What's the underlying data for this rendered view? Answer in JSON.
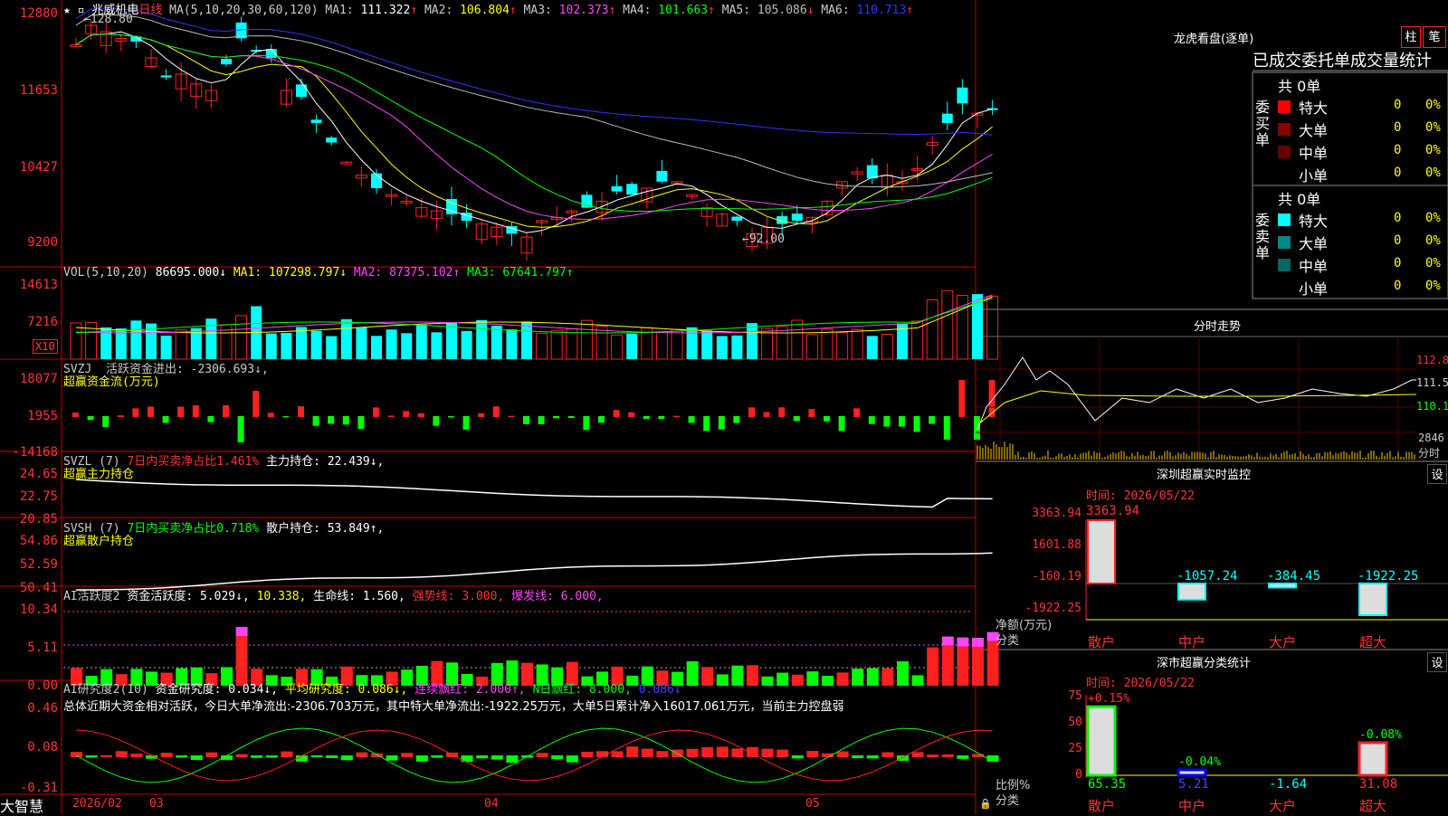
{
  "app": {
    "brand": "大智慧",
    "top_left_icons": "★ ▫"
  },
  "stock": {
    "name": "兆威机电",
    "period": "日线"
  },
  "price_panel": {
    "ma_label": "MA(5,10,20,30,60,120)",
    "ma": [
      {
        "name": "MA1",
        "value": "111.322",
        "arrow": "↑",
        "color": "#ffffff"
      },
      {
        "name": "MA2",
        "value": "106.804",
        "arrow": "↑",
        "color": "#ffff00"
      },
      {
        "name": "MA3",
        "value": "102.373",
        "arrow": "↑",
        "color": "#ff44ff"
      },
      {
        "name": "MA4",
        "value": "101.663",
        "arrow": "↑",
        "color": "#00ff00"
      },
      {
        "name": "MA5",
        "value": "105.086",
        "arrow": "↓",
        "color": "#bbbbbb"
      },
      {
        "name": "MA6",
        "value": "110.713",
        "arrow": "↑",
        "color": "#3333ff"
      }
    ],
    "y_ticks": [
      "12880",
      "11653",
      "10427",
      "9200"
    ],
    "high_note": "←128.80",
    "low_note": "←92.00"
  },
  "vol_panel": {
    "label": "VOL(5,10,20)",
    "value": "86695.000↓",
    "ma": [
      {
        "name": "MA1",
        "value": "107298.797↓",
        "color": "#ffff00"
      },
      {
        "name": "MA2",
        "value": "87375.102↑",
        "color": "#ff44ff"
      },
      {
        "name": "MA3",
        "value": "67641.797↑",
        "color": "#00ff00"
      }
    ],
    "y_ticks": [
      "14613",
      "7216"
    ],
    "unit": "X10"
  },
  "svzj_panel": {
    "label": "SVZJ",
    "title": "活跃资金进出:",
    "value": "-2306.693↓,",
    "sub": "超赢资金流(万元)",
    "y_ticks": [
      "18077",
      "1955",
      "-14168"
    ]
  },
  "svzl_panel": {
    "label": "SVZL (7)",
    "ratio": "7日内买卖净占比1.461%",
    "hold": "主力持仓: 22.439↓,",
    "sub": "超赢主力持仓",
    "y_ticks": [
      "24.65",
      "22.75",
      "20.85"
    ]
  },
  "svsh_panel": {
    "label": "SVSH (7)",
    "ratio": "7日内买卖净占比0.718%",
    "hold": "散户持仓: 53.849↑,",
    "sub": "超赢散户持仓",
    "y_ticks": [
      "54.86",
      "52.59",
      "50.41"
    ]
  },
  "ai_active": {
    "label": "AI活跃度2",
    "a": "资金活跃度: 5.029↓,",
    "b": "10.338,",
    "c": "生命线: 1.560,",
    "d": "强势线: 3.000,",
    "e": "爆发线: 6.000,",
    "y_ticks": [
      "10.34",
      "5.11",
      "0.00"
    ]
  },
  "ai_research": {
    "label": "AI研究度2(10)",
    "a": "资金研究度: 0.034↓,",
    "b": "平均研究度: 0.086↓,",
    "c": "连续飘红: 2.000↑,",
    "d": "N日飘红: 8.000,",
    "e": "0.086↓",
    "summary": "总体近期大资金相对活跃，今日大单净流出:-2306.703万元，其中特大单净流出:-1922.25万元，大单5日累计净入16017.061万元，当前主力控盘弱",
    "y_ticks": [
      "0.46",
      "0.08",
      "-0.31"
    ]
  },
  "x_axis": [
    "2026/02",
    "03",
    "04",
    "05"
  ],
  "lhb": {
    "title": "龙虎看盘(逐单)",
    "btn1": "柱",
    "btn2": "笔",
    "header": "已成交委托单成交量统计",
    "buy": {
      "side": "委买单",
      "total": "共 0单",
      "rows": [
        {
          "name": "特大",
          "v": "0",
          "p": "0%",
          "color": "#ff0000"
        },
        {
          "name": "大单",
          "v": "0",
          "p": "0%",
          "color": "#880000"
        },
        {
          "name": "中单",
          "v": "0",
          "p": "0%",
          "color": "#660000"
        },
        {
          "name": "小单",
          "v": "0",
          "p": "0%",
          "color": ""
        }
      ]
    },
    "sell": {
      "side": "委卖单",
      "total": "共 0单",
      "rows": [
        {
          "name": "特大",
          "v": "0",
          "p": "0%",
          "color": "#00ffff"
        },
        {
          "name": "大单",
          "v": "0",
          "p": "0%",
          "color": "#008888"
        },
        {
          "name": "中单",
          "v": "0",
          "p": "0%",
          "color": "#006666"
        },
        {
          "name": "小单",
          "v": "0",
          "p": "0%",
          "color": ""
        }
      ]
    }
  },
  "intraday": {
    "title": "分时走势",
    "y_ticks": [
      "112.8",
      "111.5",
      "110.1"
    ],
    "vol_tick": "2846",
    "unit": "分时"
  },
  "sz_monitor": {
    "title": "深圳超赢实时监控",
    "btn": "设",
    "time": "时间: 2026/05/22",
    "y_ticks": [
      "3363.94",
      "1601.88",
      "-160.19",
      "-1922.25"
    ],
    "unit": "净额(万元)",
    "unit2": "分类",
    "bars": [
      {
        "cat": "散户",
        "value": 3363.94,
        "label": "3363.94"
      },
      {
        "cat": "中户",
        "value": -1057.24,
        "label": "-1057.24"
      },
      {
        "cat": "大户",
        "value": -384.45,
        "label": "-384.45"
      },
      {
        "cat": "超大",
        "value": -1922.25,
        "label": "-1922.25"
      }
    ]
  },
  "sz_class": {
    "title": "深市超赢分类统计",
    "btn": "设",
    "time": "时间: 2026/05/22",
    "y_ticks": [
      "75",
      "50",
      "25",
      "0"
    ],
    "unit": "比例%",
    "unit2": "分类",
    "bars": [
      {
        "cat": "散户",
        "value": 65.35,
        "label": "65.35",
        "change": "+0.15%"
      },
      {
        "cat": "中户",
        "value": 5.21,
        "label": "5.21",
        "change": "-0.04%"
      },
      {
        "cat": "大户",
        "value": -1.64,
        "label": "-1.64",
        "change": ""
      },
      {
        "cat": "超大",
        "value": 31.08,
        "label": "31.08",
        "change": "-0.08%"
      }
    ]
  }
}
